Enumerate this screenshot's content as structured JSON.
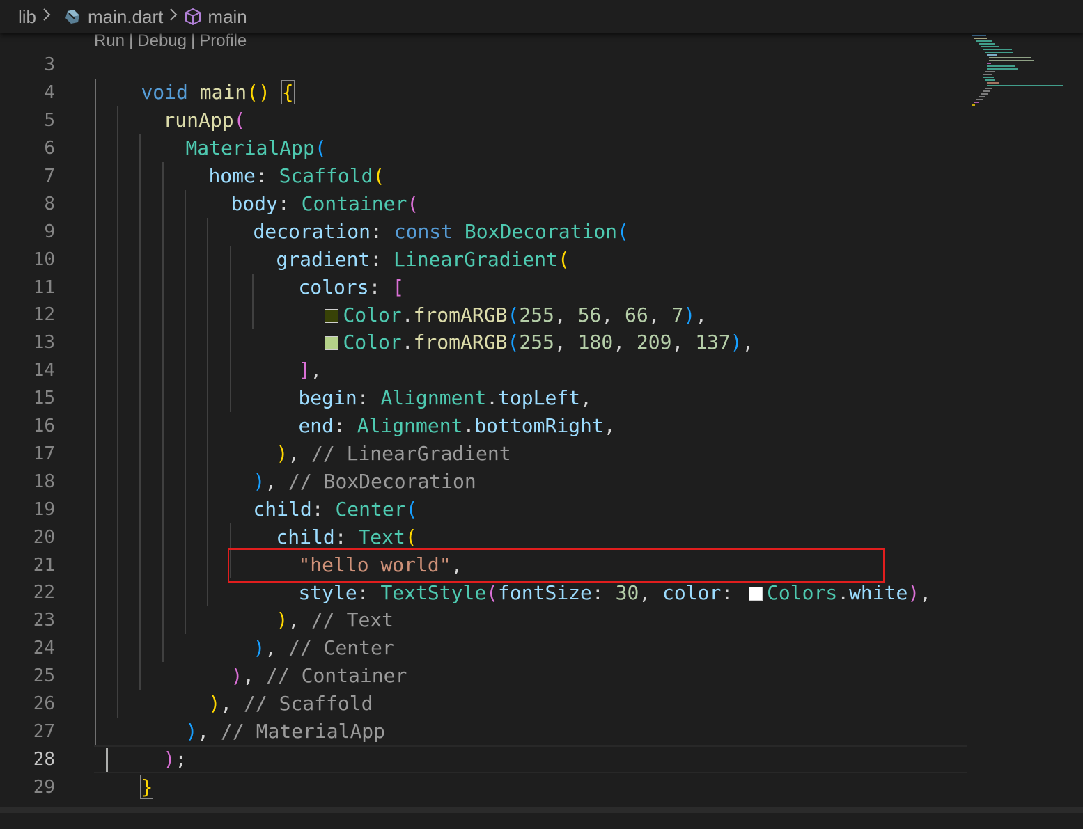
{
  "breadcrumb": {
    "folder": "lib",
    "file": "main.dart",
    "symbol": "main",
    "file_icon": "dart-icon",
    "symbol_icon": "cube-icon"
  },
  "codelens": {
    "run": "Run",
    "debug": "Debug",
    "profile": "Profile",
    "separator": "|"
  },
  "line_numbers": [
    "3",
    "4",
    "5",
    "6",
    "7",
    "8",
    "9",
    "10",
    "11",
    "12",
    "13",
    "14",
    "15",
    "16",
    "17",
    "18",
    "19",
    "20",
    "21",
    "22",
    "23",
    "24",
    "25",
    "26",
    "27",
    "28",
    "29"
  ],
  "active_line": "28",
  "code": {
    "l3": [
      "void",
      " ",
      "main",
      "()",
      " ",
      "{"
    ],
    "l4": [
      "runApp",
      "("
    ],
    "l5": [
      "MaterialApp",
      "("
    ],
    "l6": [
      "home",
      ": ",
      "Scaffold",
      "("
    ],
    "l7": [
      "body",
      ": ",
      "Container",
      "("
    ],
    "l8": [
      "decoration",
      ": ",
      "const",
      " ",
      "BoxDecoration",
      "("
    ],
    "l9": [
      "gradient",
      ": ",
      "LinearGradient",
      "("
    ],
    "l10": [
      "colors",
      ": ",
      "["
    ],
    "l11": [
      "Color",
      ".",
      "fromARGB",
      "(",
      "255",
      ", ",
      "56",
      ", ",
      "66",
      ", ",
      "7",
      ")",
      ","
    ],
    "l12": [
      "Color",
      ".",
      "fromARGB",
      "(",
      "255",
      ", ",
      "180",
      ", ",
      "209",
      ", ",
      "137",
      ")",
      ","
    ],
    "l13": [
      "]",
      ","
    ],
    "l14": [
      "begin",
      ": ",
      "Alignment",
      ".",
      "topLeft",
      ","
    ],
    "l15": [
      "end",
      ": ",
      "Alignment",
      ".",
      "bottomRight",
      ","
    ],
    "l16": [
      ")",
      ", ",
      "// LinearGradient"
    ],
    "l17": [
      ")",
      ", ",
      "// BoxDecoration"
    ],
    "l18": [
      "child",
      ": ",
      "Center",
      "("
    ],
    "l19": [
      "child",
      ": ",
      "Text",
      "("
    ],
    "l20": [
      "\"hello world\"",
      ","
    ],
    "l21": [
      "style",
      ": ",
      "TextStyle",
      "(",
      "fontSize",
      ": ",
      "30",
      ", ",
      "color",
      ": ",
      "Colors",
      ".",
      "white",
      ")",
      ","
    ],
    "l22": [
      ")",
      ", ",
      "// Text"
    ],
    "l23": [
      ")",
      ", ",
      "// Center"
    ],
    "l24": [
      ")",
      ", ",
      "// Container"
    ],
    "l25": [
      ")",
      ", ",
      "// Scaffold"
    ],
    "l26": [
      ")",
      ", ",
      "// MaterialApp"
    ],
    "l27": [
      ")",
      ";"
    ],
    "l28": [
      "}"
    ]
  },
  "color_swatches": {
    "color_1": "#384207",
    "color_2": "#b4d189",
    "colors_white": "#ffffff"
  },
  "theme": {
    "background": "#1e1e1e",
    "keyword": "#569cd6",
    "function": "#dcdcaa",
    "class": "#4ec9b0",
    "property": "#9cdcfe",
    "number": "#b5cea8",
    "string": "#ce9178",
    "comment": "#9a9a9a",
    "bracket_1": "#ffd700",
    "bracket_2": "#da70d6",
    "bracket_3": "#179fff",
    "highlight_box": "#e01e1e"
  }
}
